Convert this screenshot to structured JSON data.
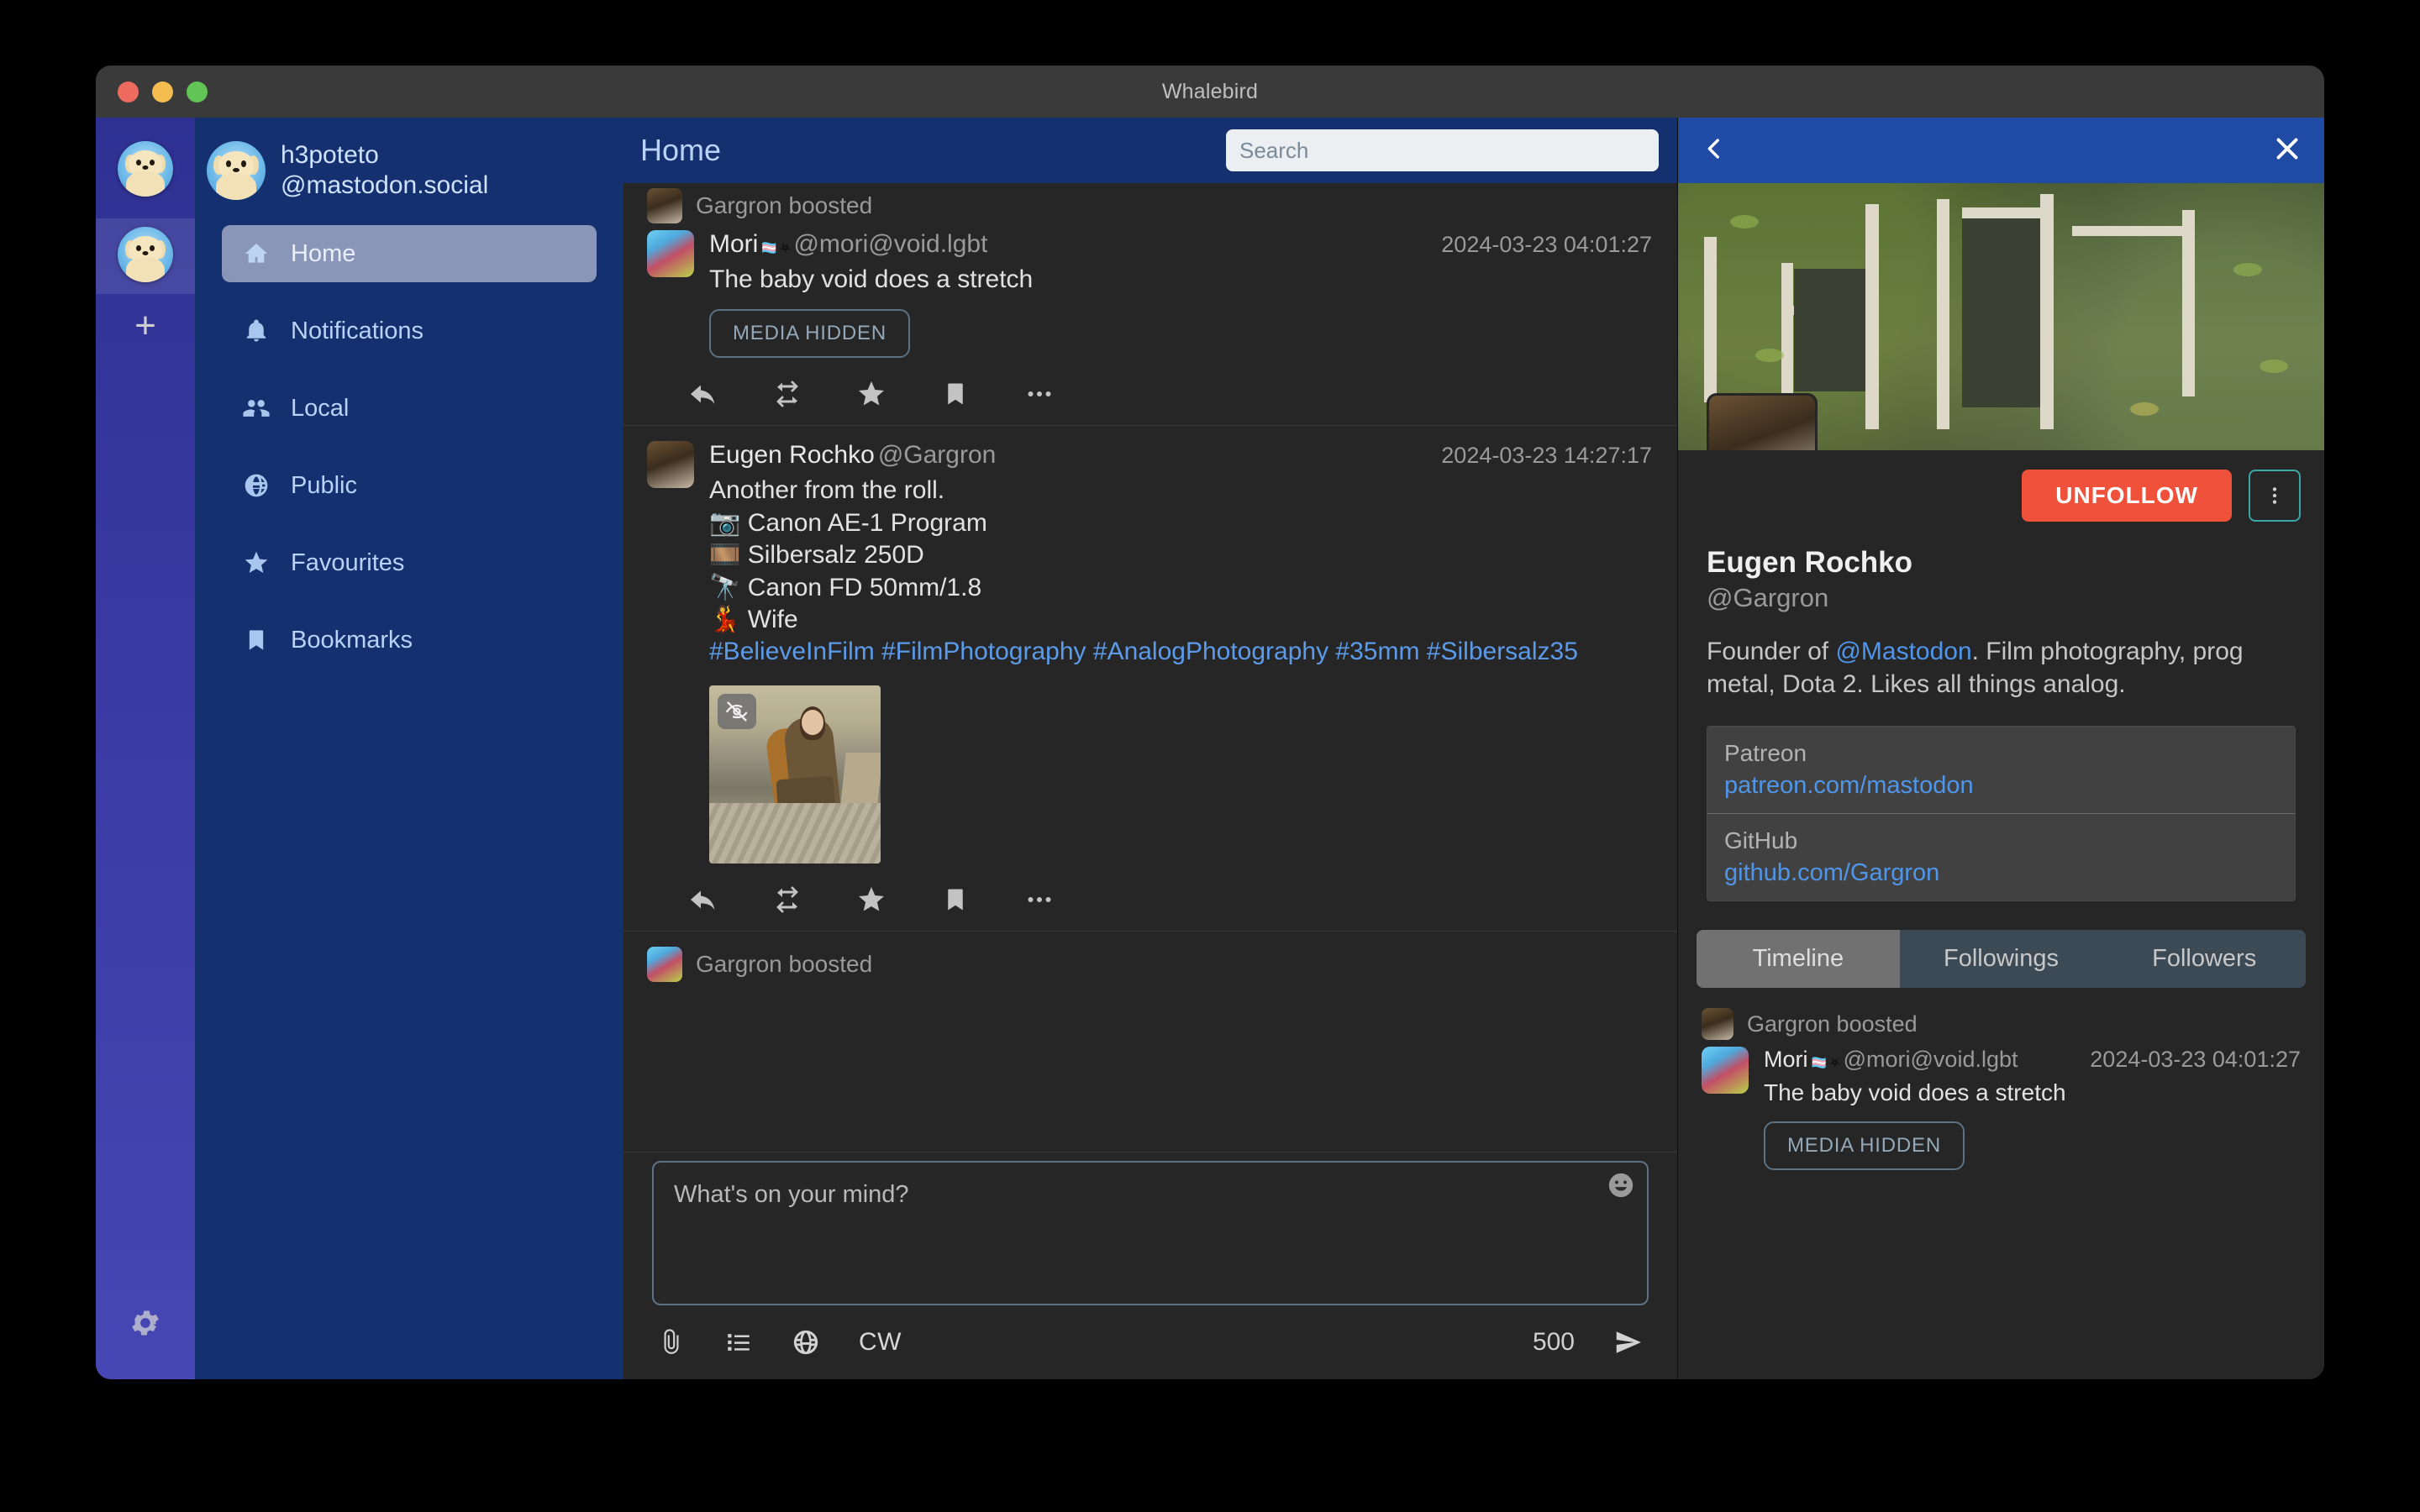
{
  "window": {
    "app_title": "Whalebird"
  },
  "rail": {
    "add_label": "+",
    "settings_icon": "gear-icon"
  },
  "account": {
    "display_name": "h3poteto",
    "handle": "@mastodon.social"
  },
  "nav": {
    "items": [
      {
        "label": "Home",
        "icon": "home-icon",
        "active": true
      },
      {
        "label": "Notifications",
        "icon": "bell-icon",
        "active": false
      },
      {
        "label": "Local",
        "icon": "people-icon",
        "active": false
      },
      {
        "label": "Public",
        "icon": "globe-icon",
        "active": false
      },
      {
        "label": "Favourites",
        "icon": "star-icon",
        "active": false
      },
      {
        "label": "Bookmarks",
        "icon": "bookmark-icon",
        "active": false
      }
    ]
  },
  "center": {
    "title": "Home",
    "search": {
      "placeholder": "Search",
      "value": ""
    },
    "statuses": [
      {
        "boost_text": "Gargron boosted",
        "display_name": "Mori",
        "name_emoji": "🏳️‍⚧️",
        "acct_emoji": "⛧",
        "acct": "@mori@void.lgbt",
        "time": "2024-03-23 04:01:27",
        "body": "The baby void does a stretch",
        "sensitive_label": "MEDIA HIDDEN",
        "actions": [
          "reply-icon",
          "boost-icon",
          "favourite-icon",
          "bookmark-icon",
          "more-icon"
        ]
      },
      {
        "boost_text": "",
        "display_name": "Eugen Rochko",
        "acct": "@Gargron",
        "time": "2024-03-23 14:27:17",
        "body_lines": [
          "Another from the roll.",
          "📷 Canon AE-1 Program",
          "🎞️ Silbersalz 250D",
          "🔭 Canon FD 50mm/1.8",
          "💃 Wife"
        ],
        "hashtags": "#BelieveInFilm #FilmPhotography #AnalogPhotography #35mm #Silbersalz35",
        "media_toggle_icon": "eye-off-icon",
        "actions": [
          "reply-icon",
          "boost-icon",
          "favourite-icon",
          "bookmark-icon",
          "more-icon"
        ]
      },
      {
        "boost_text": "Gargron boosted"
      }
    ]
  },
  "compose": {
    "placeholder": "What's on your mind?",
    "emoji_icon": "emoji-icon",
    "attach_icon": "paperclip-icon",
    "poll_icon": "poll-icon",
    "visibility_icon": "globe-icon",
    "cw_label": "CW",
    "char_count": "500",
    "send_icon": "send-icon"
  },
  "profile": {
    "back_icon": "chevron-left-icon",
    "close_icon": "close-icon",
    "unfollow_label": "UNFOLLOW",
    "more_icon": "vertical-dots-icon",
    "display_name": "Eugen Rochko",
    "handle": "@Gargron",
    "note_prefix": "Founder of ",
    "note_mention": "@Mastodon",
    "note_suffix": ". Film photography, prog metal, Dota 2. Likes all things analog.",
    "fields": [
      {
        "name": "Patreon",
        "value": "patreon.com/mastodon"
      },
      {
        "name": "GitHub",
        "value": "github.com/Gargron"
      }
    ],
    "tabs": [
      {
        "label": "Timeline",
        "active": true
      },
      {
        "label": "Followings",
        "active": false
      },
      {
        "label": "Followers",
        "active": false
      }
    ],
    "timeline": [
      {
        "boost_text": "Gargron boosted",
        "display_name": "Mori",
        "name_emoji": "🏳️‍⚧️",
        "acct_emoji": "⛧",
        "acct": "@mori@void.lgbt",
        "time": "2024-03-23 04:01:27",
        "body": "The baby void does a stretch",
        "sensitive_label": "MEDIA HIDDEN"
      }
    ]
  },
  "colors": {
    "nav_bg": "#14306e",
    "header_bg": "#1f4ba5",
    "rail_bg": "#3b3aa3",
    "unfollow": "#f0513a",
    "link": "#4f96ea",
    "panel_bg": "#262626"
  }
}
